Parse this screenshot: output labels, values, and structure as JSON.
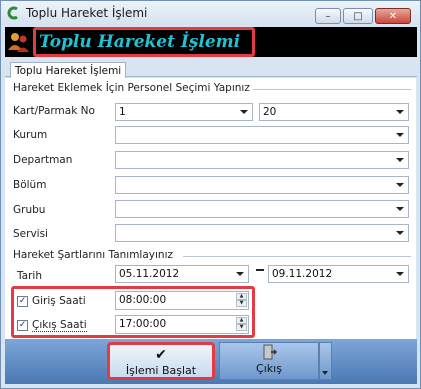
{
  "window": {
    "title": "Toplu Hareket İşlemi",
    "minimize_icon": "minimize-icon",
    "maximize_icon": "maximize-icon",
    "close_icon": "close-icon"
  },
  "header": {
    "title": "Toplu Hareket İşlemi",
    "icon": "users-icon"
  },
  "tabs": [
    {
      "label": "Toplu Hareket İşlemi",
      "selected": true
    }
  ],
  "personnel_group": {
    "title": "Hareket Eklemek İçin Personel Seçimi Yapınız",
    "fields": {
      "kart": {
        "label": "Kart/Parmak No",
        "from": "1",
        "to": "20"
      },
      "kurum": {
        "label": "Kurum",
        "value": ""
      },
      "departman": {
        "label": "Departman",
        "value": ""
      },
      "bolum": {
        "label": "Bölüm",
        "value": ""
      },
      "grubu": {
        "label": "Grubu",
        "value": ""
      },
      "servisi": {
        "label": "Servisi",
        "value": ""
      }
    }
  },
  "conditions_group": {
    "title": "Hareket Şartlarını Tanımlayınız",
    "tarih": {
      "label": "Tarih",
      "from": "05.11.2012",
      "to": "09.11.2012"
    },
    "giris": {
      "label": "Giriş Saati",
      "checked": true,
      "value": "08:00:00"
    },
    "cikis": {
      "label": "Çıkış Saati",
      "checked": true,
      "value": "17:00:00"
    }
  },
  "buttons": {
    "start": {
      "label": "İşlemi Başlat",
      "icon": "checkmark-icon"
    },
    "exit": {
      "label": "Çıkış",
      "icon": "exit-door-icon"
    }
  },
  "colors": {
    "highlight": "#e23b44",
    "header_text": "#1ec3d4",
    "toolbar": "#4b78b4"
  }
}
